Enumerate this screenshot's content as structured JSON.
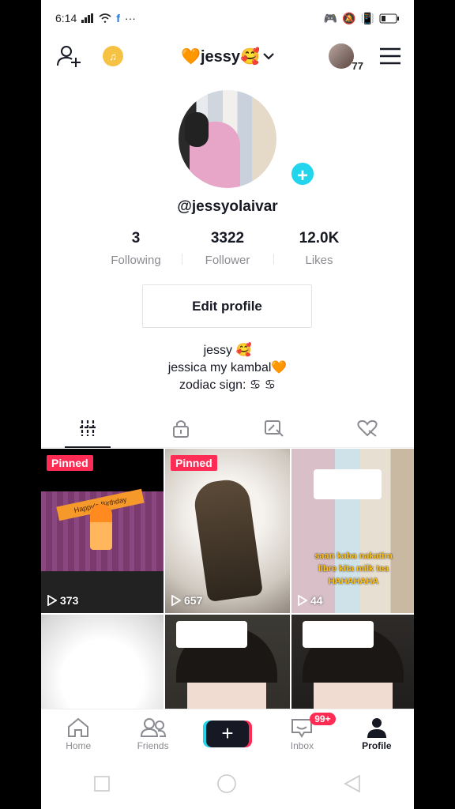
{
  "status_bar": {
    "time": "6:14",
    "extra": "···"
  },
  "top_bar": {
    "username": "🧡jessy🥰",
    "avatar_count": "77"
  },
  "profile": {
    "handle": "@jessyolaivar"
  },
  "stats": [
    {
      "value": "3",
      "label": "Following"
    },
    {
      "value": "3322",
      "label": "Follower"
    },
    {
      "value": "12.0K",
      "label": "Likes"
    }
  ],
  "edit_profile_label": "Edit profile",
  "bio": [
    "jessy 🥰",
    "jessica my kambal🧡",
    "zodiac sign: ♋ ♋"
  ],
  "videos": [
    {
      "pinned_label": "Pinned",
      "views": "373",
      "banner": "Happy's Birthday"
    },
    {
      "pinned_label": "Pinned",
      "views": "657"
    },
    {
      "views": "44",
      "caption": "saan kaba nakatira\nlibre kita milk tea\nHAHAHAHA"
    },
    {},
    {},
    {}
  ],
  "nav": {
    "home": "Home",
    "friends": "Friends",
    "inbox": "Inbox",
    "inbox_badge": "99+",
    "profile": "Profile"
  },
  "colors": {
    "accent_red": "#fe2c55",
    "accent_cyan": "#20d5ec"
  }
}
